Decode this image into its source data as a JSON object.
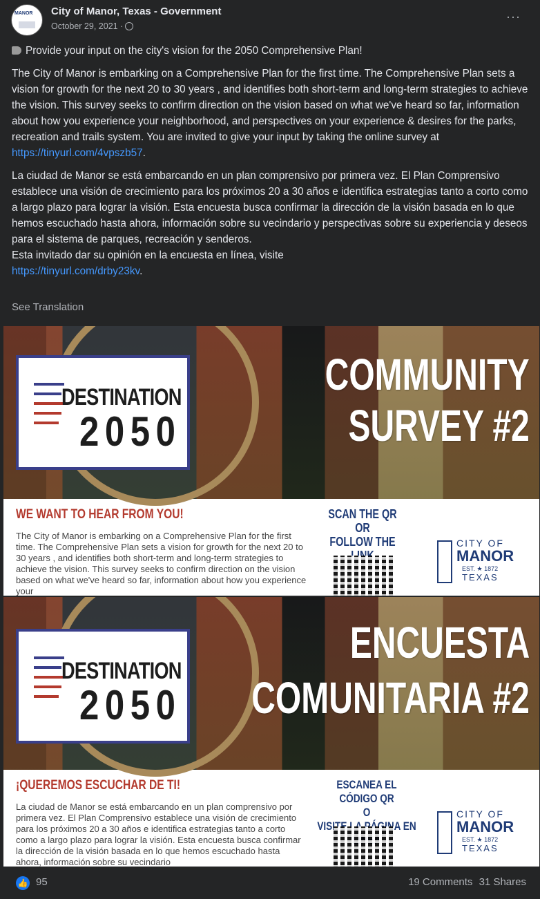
{
  "post": {
    "page_name": "City of Manor, Texas - Government",
    "date": "October 29, 2021 ·",
    "more": "···",
    "intro": "Provide your input on the city's vision for the 2050 Comprehensive Plan!",
    "paragraph_en": "The City of Manor is embarking on a Comprehensive Plan for the first time. The Comprehensive Plan sets a vision for growth for the next 20 to 30 years , and identifies both short-term and long-term strategies to achieve the vision. This survey seeks to confirm direction on the vision based on what we've heard so far, information about how you experience your neighborhood, and perspectives on your experience & desires for the parks, recreation and trails system. You are invited to give your input by taking the online survey at",
    "link_en": "https://tinyurl.com/4vpszb57",
    "paragraph_es": "La ciudad de Manor se está embarcando en un plan comprensivo por primera vez. El Plan Comprensivo establece una visión de crecimiento para los próximos 20 a 30 años e identifica estrategias tanto a corto como a largo plazo para lograr la visión. Esta encuesta busca confirmar la dirección de la visión basada en lo que hemos escuchado hasta ahora, información sobre su vecindario y perspectivas sobre su experiencia y deseos para el sistema de parques, recreación y senderos.",
    "invite_es": "Esta invitado dar su opinión en la encuesta en línea, visite",
    "link_es": "https://tinyurl.com/drby23kv",
    "see_translation": "See Translation"
  },
  "image1": {
    "logo_top": "DESTINATION",
    "logo_bottom": "2050",
    "headline_line1": "COMMUNITY",
    "headline_line2": "SURVEY #2",
    "want": "WE WANT TO HEAR FROM YOU!",
    "para": "The City of Manor is embarking on a Comprehensive Plan for the first time. The Comprehensive Plan sets a vision for growth for the next 20 to 30 years , and identifies both short-term and long-term strategies to achieve the vision. This survey seeks to confirm direction on the vision based on what we've heard so far, information about how you experience your",
    "scan_line1": "SCAN THE QR",
    "scan_line2": "OR",
    "scan_line3": "FOLLOW THE LINK",
    "city_of": "CITY OF",
    "manor": "MANOR",
    "est": "EST. ★ 1872",
    "texas": "TEXAS"
  },
  "image2": {
    "logo_top": "DESTINATION",
    "logo_bottom": "2050",
    "headline_line1": "ENCUESTA",
    "headline_line2": "COMUNITARIA #2",
    "want": "¡QUEREMOS ESCUCHAR DE TI!",
    "para": "La ciudad de Manor se está embarcando en un plan comprensivo por primera vez. El Plan Comprensivo establece una visión de crecimiento para los próximos 20 a 30 años e identifica estrategias tanto a corto como a largo plazo para lograr la visión. Esta encuesta busca confirmar la dirección de la visión basada en lo que hemos escuchado hasta ahora, información sobre su vecindario",
    "scan_line1": "ESCANEA EL CÓDIGO QR",
    "scan_line2": "O",
    "scan_line3": "VISITE LA PÁGINA EN LÍNEA",
    "city_of": "CITY OF",
    "manor": "MANOR",
    "est": "EST. ★ 1872",
    "texas": "TEXAS"
  },
  "footer": {
    "like_count": "95",
    "comments": "19 Comments",
    "shares": "31 Shares"
  },
  "colors": {
    "link": "#4599ff",
    "background": "#242526",
    "like_blue": "#1877f2"
  }
}
